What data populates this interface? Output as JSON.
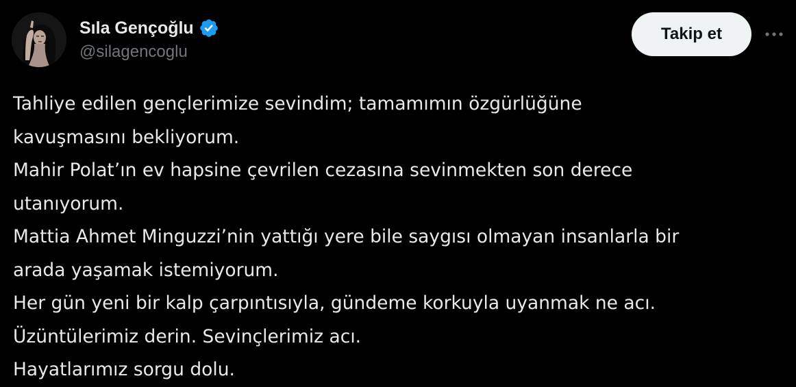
{
  "author": {
    "display_name": "Sıla Gençoğlu",
    "handle": "@silagencoglu",
    "verified": true
  },
  "actions": {
    "follow_label": "Takip et",
    "more_icon": "more-horizontal-icon"
  },
  "tweet": {
    "lines": [
      "Tahliye edilen gençlerimize sevindim; tamamımın özgürlüğüne",
      "kavuşmasını bekliyorum.",
      "Mahir Polat’ın ev hapsine çevrilen cezasına sevinmekten son derece",
      "utanıyorum.",
      "Mattia Ahmet Minguzzi’nin yattığı yere bile saygısı olmayan insanlarla bir",
      "arada yaşamak istemiyorum.",
      "Her gün yeni bir kalp çarpıntısıyla, gündeme korkuyla uyanmak ne acı.",
      "Üzüntülerimiz derin. Sevinçlerimiz acı.",
      "Hayatlarımız sorgu dolu."
    ]
  },
  "colors": {
    "background": "#000000",
    "text_primary": "#e7e9ea",
    "text_secondary": "#71767b",
    "verified_badge": "#1d9bf0",
    "follow_button_bg": "#eff3f4",
    "follow_button_text": "#0f1419"
  }
}
